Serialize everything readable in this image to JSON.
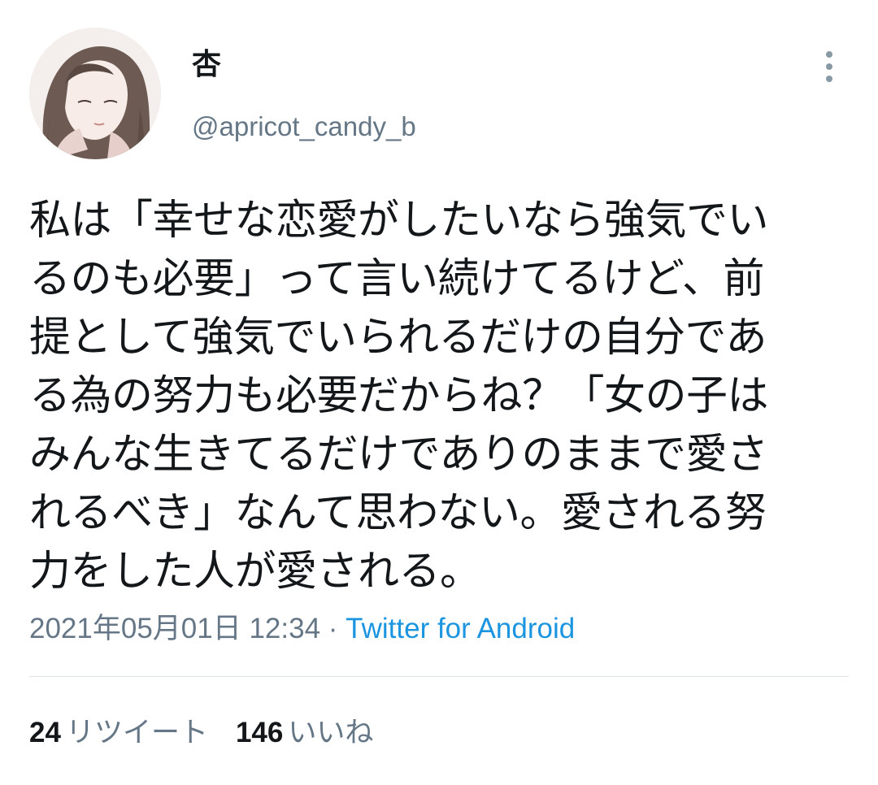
{
  "user": {
    "display_name": "杏",
    "handle": "@apricot_candy_b",
    "avatar_icon": "portrait-illustration"
  },
  "menu": {
    "icon": "more-vertical-icon"
  },
  "tweet": {
    "lines": [
      "私は「幸せな恋愛がしたいなら強気でい",
      "るのも必要」って言い続けてるけど、前",
      "提として強気でいられるだけの自分であ",
      "る為の努力も必要だからね？「女の子は",
      "みんな生きてるだけでありのままで愛さ",
      "れるべき」なんて思わない。愛される努",
      "力をした人が愛される。"
    ]
  },
  "meta": {
    "timestamp": "2021年05月01日 12:34",
    "separator": " · ",
    "source": "Twitter for Android"
  },
  "stats": {
    "retweets_count": "24",
    "retweets_label": "リツイート",
    "likes_count": "146",
    "likes_label": "いいね"
  },
  "colors": {
    "text": "#14171a",
    "secondary": "#657786",
    "link": "#1b95e0",
    "divider": "#dfe3e7"
  }
}
